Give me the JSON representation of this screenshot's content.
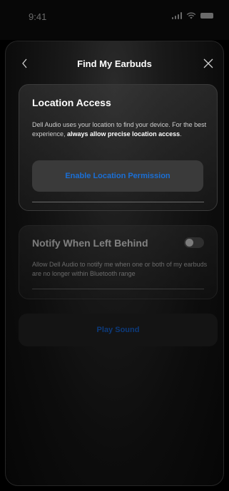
{
  "status_bar": {
    "time": "9:41"
  },
  "nav": {
    "title": "Find My Earbuds",
    "back_icon": "chevron-left-icon",
    "close_icon": "close-icon"
  },
  "location_card": {
    "title": "Location Access",
    "body_prefix": "Dell Audio uses your location to find your device. For the best experience, ",
    "body_bold": "always allow precise location access",
    "body_suffix": ".",
    "button_label": "Enable Location Permission"
  },
  "notify_card": {
    "title": "Notify When Left Behind",
    "toggle_on": false,
    "body": "Allow Dell Audio to notify me when one or both of my earbuds are no longer within Bluetooth range"
  },
  "play_sound": {
    "label": "Play Sound"
  },
  "colors": {
    "accent_blue": "#1a6fd6",
    "disabled_blue": "#0d3a7a",
    "card_border": "#3a3a3a"
  }
}
